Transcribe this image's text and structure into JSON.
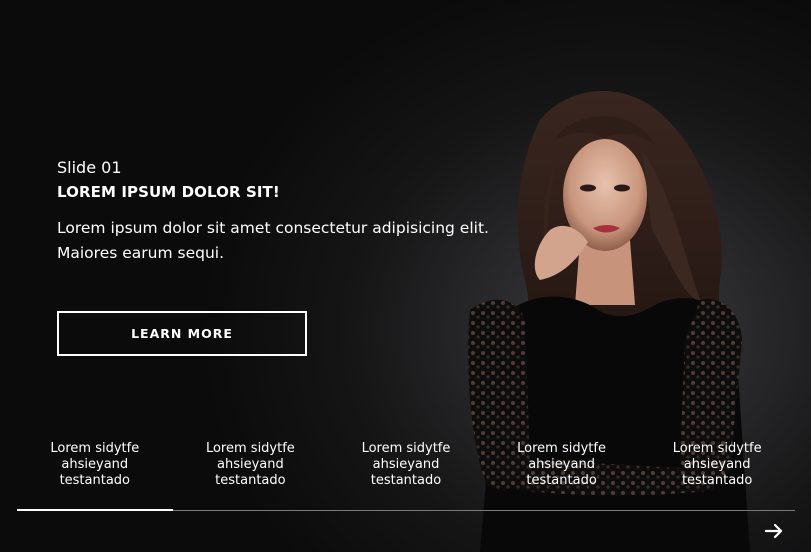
{
  "slide": {
    "label": "Slide 01",
    "title": "LOREM IPSUM DOLOR SIT!",
    "description_line1": "Lorem ipsum dolor sit amet consectetur adipisicing elit.",
    "description_line2": "Maiores earum sequi.",
    "cta_label": "LEARN MORE"
  },
  "tabs": [
    {
      "line1": "Lorem sidytfe",
      "line2": "ahsieyand",
      "line3": "testantado"
    },
    {
      "line1": "Lorem sidytfe",
      "line2": "ahsieyand",
      "line3": "testantado"
    },
    {
      "line1": "Lorem sidytfe",
      "line2": "ahsieyand",
      "line3": "testantado"
    },
    {
      "line1": "Lorem sidytfe",
      "line2": "ahsieyand",
      "line3": "testantado"
    },
    {
      "line1": "Lorem sidytfe",
      "line2": "ahsieyand",
      "line3": "testantado"
    }
  ],
  "progress": {
    "active_tab_index": 0,
    "active_fraction": 0.2
  },
  "icons": {
    "next": "arrow-right-icon"
  },
  "colors": {
    "background": "#0a0a0a",
    "text": "#ffffff",
    "track": "#7a7a7a"
  }
}
